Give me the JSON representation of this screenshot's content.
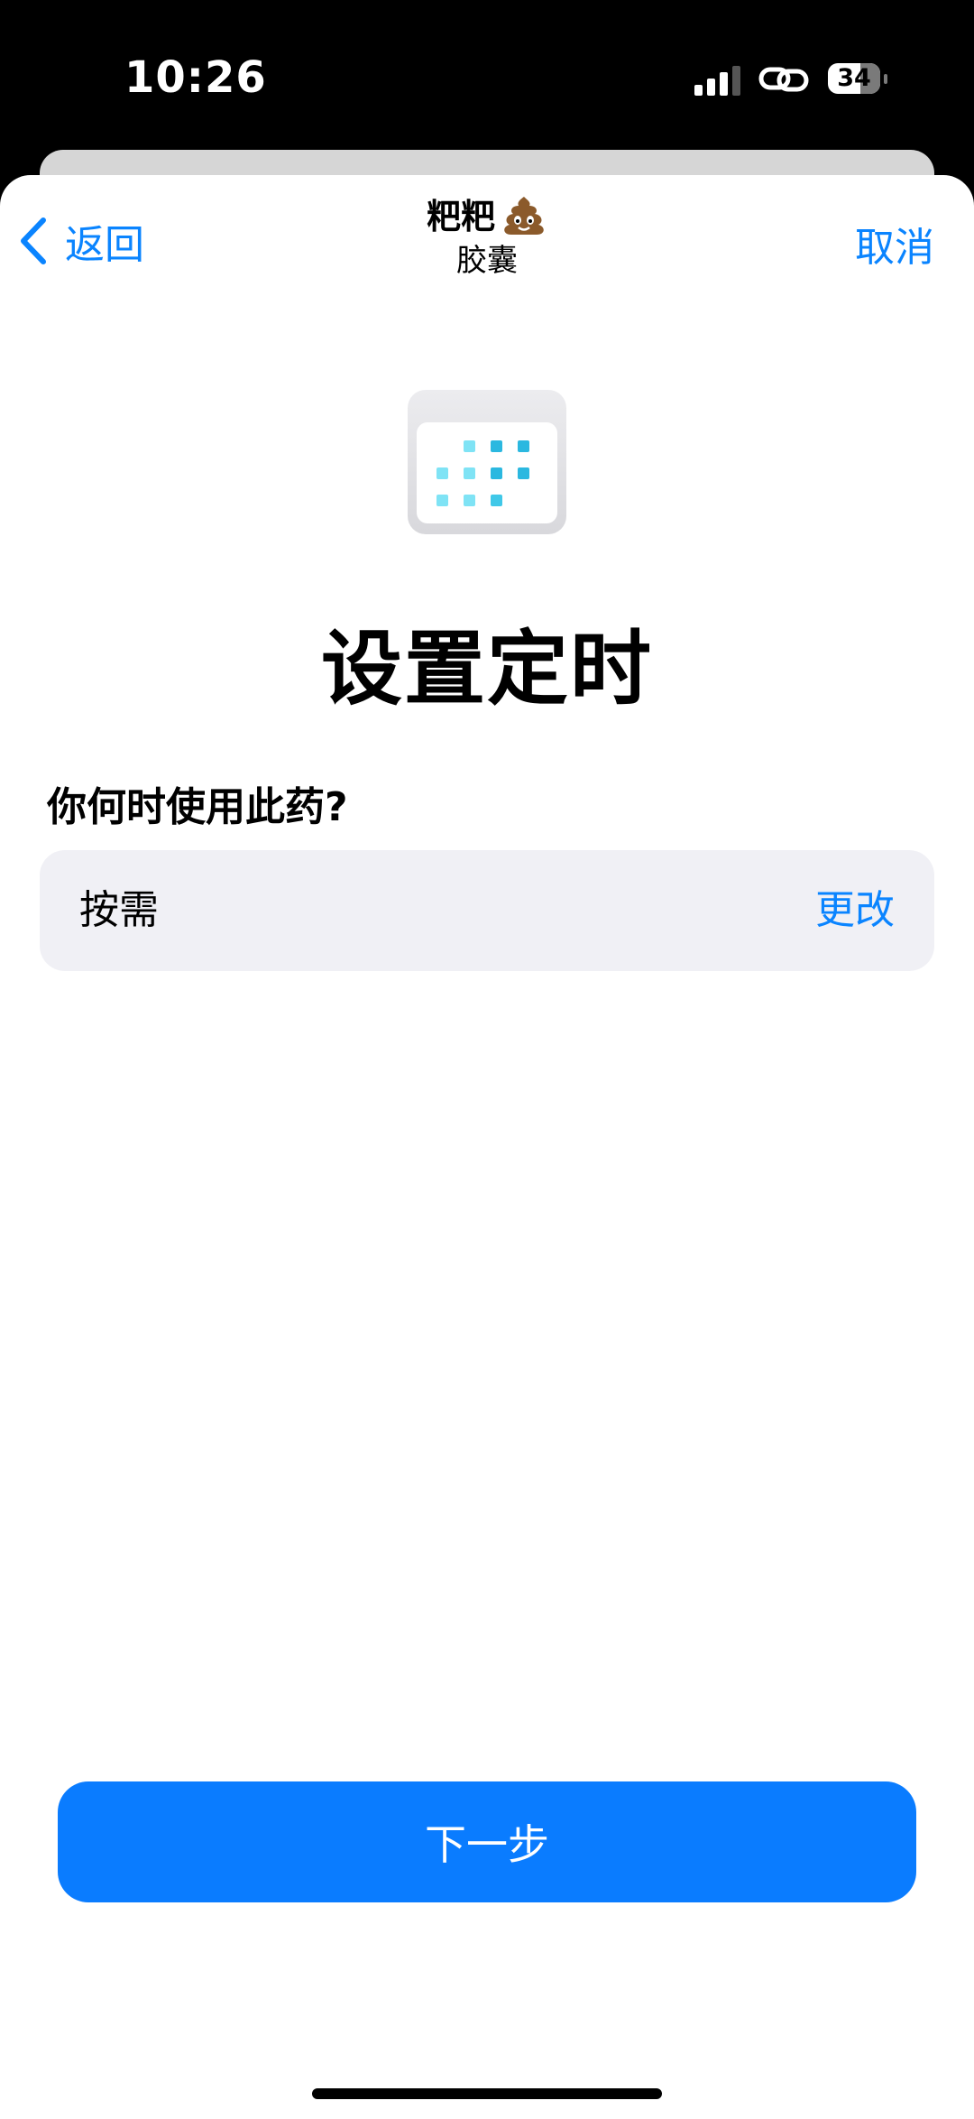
{
  "status_bar": {
    "time": "10:26",
    "battery_level": "34",
    "icons": [
      "signal-icon",
      "link-icon",
      "battery-icon"
    ]
  },
  "nav": {
    "back_label": "返回",
    "title": "粑粑",
    "title_emoji_icon": "poop-icon",
    "subtitle": "胶囊",
    "cancel_label": "取消"
  },
  "hero_icon": "calendar-icon",
  "page": {
    "title": "设置定时",
    "question": "你何时使用此药?"
  },
  "schedule": {
    "value": "按需",
    "change_label": "更改"
  },
  "footer": {
    "next_label": "下一步"
  },
  "colors": {
    "accent": "#0a84ff",
    "button": "#0a7cff",
    "row_background": "#f0f0f5",
    "calendar_dots_light": "#7fe3f5",
    "calendar_dots_dark": "#2bb8e0"
  }
}
